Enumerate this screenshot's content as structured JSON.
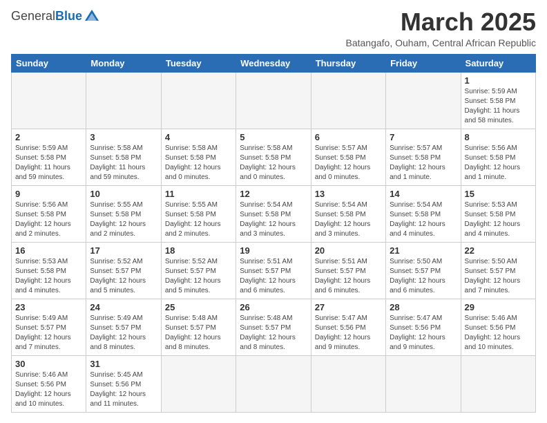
{
  "logo": {
    "general": "General",
    "blue": "Blue"
  },
  "title": "March 2025",
  "subtitle": "Batangafo, Ouham, Central African Republic",
  "days_of_week": [
    "Sunday",
    "Monday",
    "Tuesday",
    "Wednesday",
    "Thursday",
    "Friday",
    "Saturday"
  ],
  "weeks": [
    [
      {
        "day": "",
        "info": "",
        "empty": true
      },
      {
        "day": "",
        "info": "",
        "empty": true
      },
      {
        "day": "",
        "info": "",
        "empty": true
      },
      {
        "day": "",
        "info": "",
        "empty": true
      },
      {
        "day": "",
        "info": "",
        "empty": true
      },
      {
        "day": "",
        "info": "",
        "empty": true
      },
      {
        "day": "1",
        "info": "Sunrise: 5:59 AM\nSunset: 5:58 PM\nDaylight: 11 hours\nand 58 minutes."
      }
    ],
    [
      {
        "day": "2",
        "info": "Sunrise: 5:59 AM\nSunset: 5:58 PM\nDaylight: 11 hours\nand 59 minutes."
      },
      {
        "day": "3",
        "info": "Sunrise: 5:58 AM\nSunset: 5:58 PM\nDaylight: 11 hours\nand 59 minutes."
      },
      {
        "day": "4",
        "info": "Sunrise: 5:58 AM\nSunset: 5:58 PM\nDaylight: 12 hours\nand 0 minutes."
      },
      {
        "day": "5",
        "info": "Sunrise: 5:58 AM\nSunset: 5:58 PM\nDaylight: 12 hours\nand 0 minutes."
      },
      {
        "day": "6",
        "info": "Sunrise: 5:57 AM\nSunset: 5:58 PM\nDaylight: 12 hours\nand 0 minutes."
      },
      {
        "day": "7",
        "info": "Sunrise: 5:57 AM\nSunset: 5:58 PM\nDaylight: 12 hours\nand 1 minute."
      },
      {
        "day": "8",
        "info": "Sunrise: 5:56 AM\nSunset: 5:58 PM\nDaylight: 12 hours\nand 1 minute."
      }
    ],
    [
      {
        "day": "9",
        "info": "Sunrise: 5:56 AM\nSunset: 5:58 PM\nDaylight: 12 hours\nand 2 minutes."
      },
      {
        "day": "10",
        "info": "Sunrise: 5:55 AM\nSunset: 5:58 PM\nDaylight: 12 hours\nand 2 minutes."
      },
      {
        "day": "11",
        "info": "Sunrise: 5:55 AM\nSunset: 5:58 PM\nDaylight: 12 hours\nand 2 minutes."
      },
      {
        "day": "12",
        "info": "Sunrise: 5:54 AM\nSunset: 5:58 PM\nDaylight: 12 hours\nand 3 minutes."
      },
      {
        "day": "13",
        "info": "Sunrise: 5:54 AM\nSunset: 5:58 PM\nDaylight: 12 hours\nand 3 minutes."
      },
      {
        "day": "14",
        "info": "Sunrise: 5:54 AM\nSunset: 5:58 PM\nDaylight: 12 hours\nand 4 minutes."
      },
      {
        "day": "15",
        "info": "Sunrise: 5:53 AM\nSunset: 5:58 PM\nDaylight: 12 hours\nand 4 minutes."
      }
    ],
    [
      {
        "day": "16",
        "info": "Sunrise: 5:53 AM\nSunset: 5:58 PM\nDaylight: 12 hours\nand 4 minutes."
      },
      {
        "day": "17",
        "info": "Sunrise: 5:52 AM\nSunset: 5:57 PM\nDaylight: 12 hours\nand 5 minutes."
      },
      {
        "day": "18",
        "info": "Sunrise: 5:52 AM\nSunset: 5:57 PM\nDaylight: 12 hours\nand 5 minutes."
      },
      {
        "day": "19",
        "info": "Sunrise: 5:51 AM\nSunset: 5:57 PM\nDaylight: 12 hours\nand 6 minutes."
      },
      {
        "day": "20",
        "info": "Sunrise: 5:51 AM\nSunset: 5:57 PM\nDaylight: 12 hours\nand 6 minutes."
      },
      {
        "day": "21",
        "info": "Sunrise: 5:50 AM\nSunset: 5:57 PM\nDaylight: 12 hours\nand 6 minutes."
      },
      {
        "day": "22",
        "info": "Sunrise: 5:50 AM\nSunset: 5:57 PM\nDaylight: 12 hours\nand 7 minutes."
      }
    ],
    [
      {
        "day": "23",
        "info": "Sunrise: 5:49 AM\nSunset: 5:57 PM\nDaylight: 12 hours\nand 7 minutes."
      },
      {
        "day": "24",
        "info": "Sunrise: 5:49 AM\nSunset: 5:57 PM\nDaylight: 12 hours\nand 8 minutes."
      },
      {
        "day": "25",
        "info": "Sunrise: 5:48 AM\nSunset: 5:57 PM\nDaylight: 12 hours\nand 8 minutes."
      },
      {
        "day": "26",
        "info": "Sunrise: 5:48 AM\nSunset: 5:57 PM\nDaylight: 12 hours\nand 8 minutes."
      },
      {
        "day": "27",
        "info": "Sunrise: 5:47 AM\nSunset: 5:56 PM\nDaylight: 12 hours\nand 9 minutes."
      },
      {
        "day": "28",
        "info": "Sunrise: 5:47 AM\nSunset: 5:56 PM\nDaylight: 12 hours\nand 9 minutes."
      },
      {
        "day": "29",
        "info": "Sunrise: 5:46 AM\nSunset: 5:56 PM\nDaylight: 12 hours\nand 10 minutes."
      }
    ],
    [
      {
        "day": "30",
        "info": "Sunrise: 5:46 AM\nSunset: 5:56 PM\nDaylight: 12 hours\nand 10 minutes."
      },
      {
        "day": "31",
        "info": "Sunrise: 5:45 AM\nSunset: 5:56 PM\nDaylight: 12 hours\nand 11 minutes."
      },
      {
        "day": "",
        "info": "",
        "empty": true
      },
      {
        "day": "",
        "info": "",
        "empty": true
      },
      {
        "day": "",
        "info": "",
        "empty": true
      },
      {
        "day": "",
        "info": "",
        "empty": true
      },
      {
        "day": "",
        "info": "",
        "empty": true
      }
    ]
  ]
}
